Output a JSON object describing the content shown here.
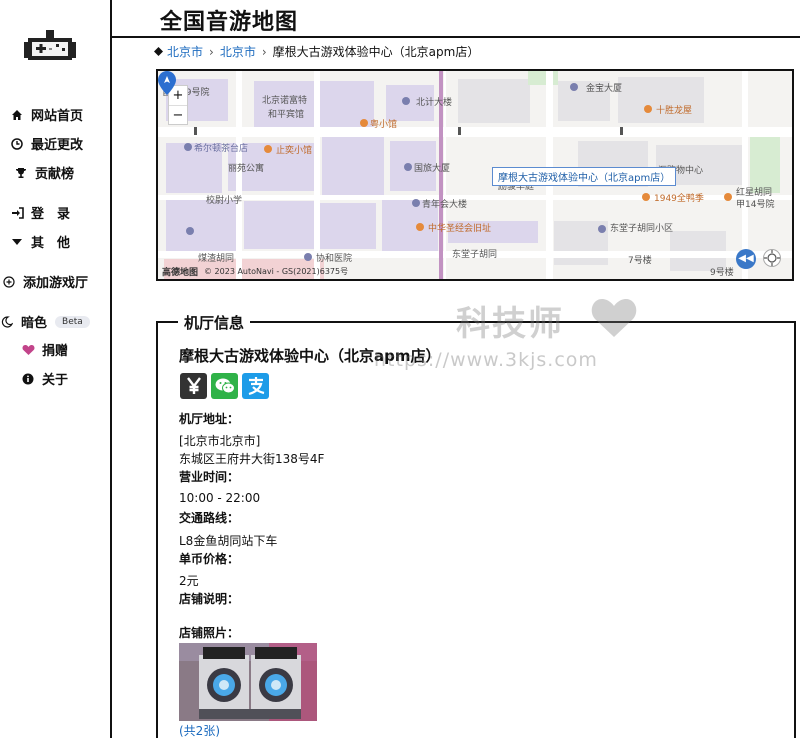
{
  "site": {
    "title": "全国音游地图"
  },
  "sidebar": {
    "items": [
      {
        "label": "网站首页",
        "icon": "home-icon"
      },
      {
        "label": "最近更改",
        "icon": "clock-icon"
      },
      {
        "label": "贡献榜",
        "icon": "trophy-icon"
      },
      {
        "label": "登　录",
        "icon": "login-icon"
      },
      {
        "label": "其　他",
        "icon": "caret-down-icon"
      },
      {
        "label": "添加游戏厅",
        "icon": "plus-circle-icon"
      },
      {
        "label": "暗色",
        "icon": "moon-icon",
        "badge": "Beta"
      },
      {
        "label": "捐赠",
        "icon": "heart-icon"
      },
      {
        "label": "关于",
        "icon": "info-icon"
      }
    ]
  },
  "breadcrumb": {
    "items": [
      "北京市",
      "北京市",
      "摩根大古游戏体验中心（北京apm店）"
    ]
  },
  "map": {
    "popup": "摩根大古游戏体验中心（北京apm店）",
    "zoom_in": "+",
    "zoom_out": "−",
    "provider": "高德地图",
    "credit": "© 2023 AutoNavi - GS(2021)6375号",
    "labels": [
      "首创19号院",
      "北京诺富特和平宾馆",
      "北计大楼",
      "金宝大厦",
      "十胜龙屋",
      "粤小馆",
      "希尔顿茶台店",
      "止奕小馆",
      "丽苑公寓",
      "国旅大厦",
      "励骏华庭",
      "校尉小学",
      "青年会大楼",
      "中华圣经会旧址",
      "东堂子胡同小区",
      "1949全鸭季",
      "红星胡同甲14号院",
      "煤渣胡同",
      "协和医院",
      "东堂子胡同",
      "7号楼",
      "9号楼",
      "汇购物中心"
    ],
    "colors": {
      "block": "#d9d4ea",
      "road": "#ffffff",
      "main_road": "#b68bb8"
    }
  },
  "info": {
    "section_title": "机厅信息",
    "venue_name": "摩根大古游戏体验中心（北京apm店）",
    "payment_icons": [
      "yen-icon",
      "wechat-pay-icon",
      "alipay-icon"
    ],
    "address_label": "机厅地址：",
    "address_region": "[北京市北京市]",
    "address_detail": "东城区王府井大街138号4F",
    "hours_label": "营业时间：",
    "hours": "10:00 - 22:00",
    "transit_label": "交通路线：",
    "transit": "L8金鱼胡同站下车",
    "price_label": "单币价格：",
    "price": "2元",
    "desc_label": "店铺说明：",
    "photos_label": "店铺照片：",
    "photo_count": "(共2张)"
  },
  "watermark": {
    "line1": "科技师",
    "line2": "https://www.3kjs.com"
  }
}
